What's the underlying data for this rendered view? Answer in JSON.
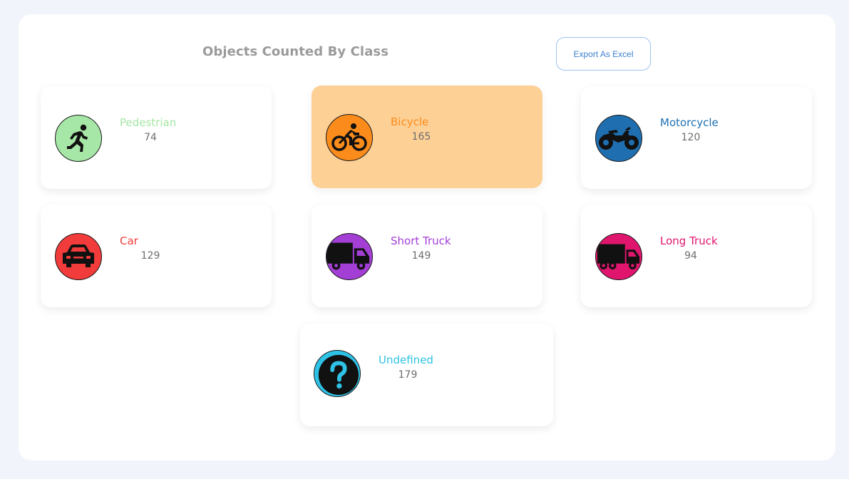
{
  "header": {
    "title": "Objects Counted By Class",
    "export_label": "Export As Excel"
  },
  "classes": [
    {
      "label": "Pedestrian",
      "count": "74",
      "color": "#a6e6a6",
      "icon": "pedestrian-icon"
    },
    {
      "label": "Bicycle",
      "count": "165",
      "color": "#fb8c1c",
      "icon": "bicycle-icon"
    },
    {
      "label": "Motorcycle",
      "count": "120",
      "color": "#1f6fb0",
      "icon": "motorcycle-icon"
    },
    {
      "label": "Car",
      "count": "129",
      "color": "#f23b3b",
      "icon": "car-icon"
    },
    {
      "label": "Short Truck",
      "count": "149",
      "color": "#a43fd6",
      "icon": "short-truck-icon"
    },
    {
      "label": "Long Truck",
      "count": "94",
      "color": "#e0166e",
      "icon": "long-truck-icon"
    },
    {
      "label": "Undefined",
      "count": "179",
      "color": "#2ec2e6",
      "icon": "question-icon"
    }
  ],
  "selected_class": "Bicycle"
}
